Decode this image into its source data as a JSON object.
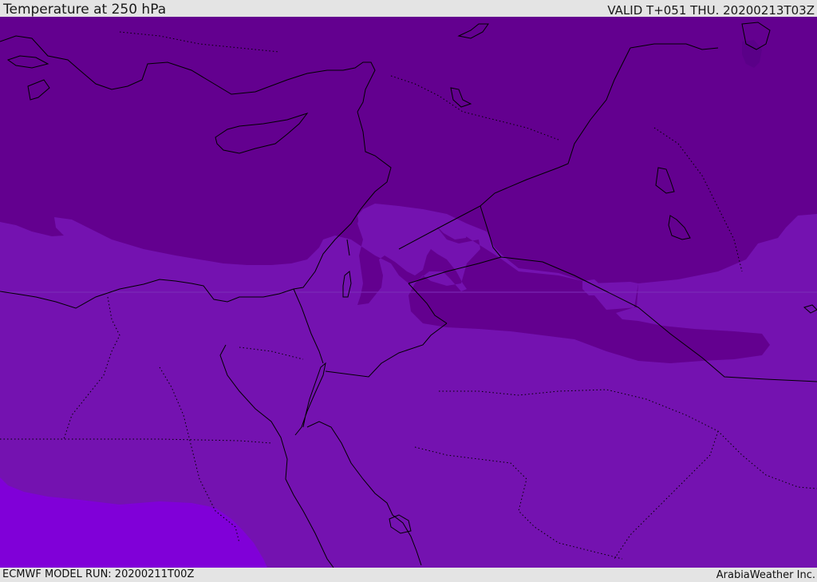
{
  "header": {
    "title": "Temperature at 250 hPa",
    "valid": "VALID T+051 THU. 20200213T03Z"
  },
  "footer": {
    "model_run": "ECMWF MODEL RUN: 20200211T00Z",
    "credit": "ArabiaWeather Inc."
  },
  "map": {
    "colors": {
      "band_cold": "#63008f",
      "band_mid": "#7412b0",
      "band_warm": "#8000d8",
      "band_deep": "#5a0088",
      "coastline": "#000000"
    }
  }
}
